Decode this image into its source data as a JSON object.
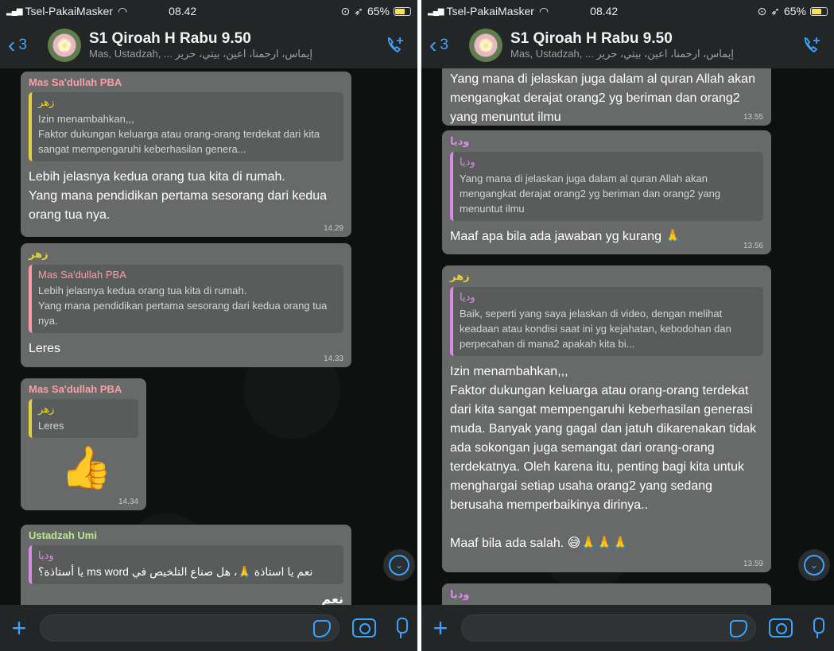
{
  "colors": {
    "accent": "#3aa3ff",
    "bubble": "#686a69",
    "sender_mas": "#ff9ba5",
    "sender_zahr": "#e6d23a",
    "sender_umi": "#b8e986",
    "sender_wadia": "#d98ce6",
    "battery": "#ffe14d"
  },
  "status": {
    "carrier": "Tsel-PakaiMasker",
    "time": "08.42",
    "battery": "65%"
  },
  "header": {
    "back_count": "3",
    "title": "S1 Qiroah H Rabu 9.50",
    "members": "Mas, Ustadzah, ... إيماس، ارحمنا، اعين، بيتي، حرير"
  },
  "left_chat": {
    "m1": {
      "sender": "Mas Sa'dullah PBA",
      "quote_author": "زهر",
      "quote_text": "Izin menambahkan,,,\nFaktor dukungan keluarga atau orang-orang terdekat dari kita sangat mempengaruhi keberhasilan genera...",
      "body": "Lebih jelasnya kedua orang tua kita di rumah.\nYang mana pendidikan pertama sesorang dari kedua orang tua nya.",
      "time": "14.29"
    },
    "m2": {
      "sender": "زهر",
      "quote_author": "Mas Sa'dullah PBA",
      "quote_text": "Lebih jelasnya kedua orang tua kita di rumah.\nYang mana pendidikan pertama sesorang dari kedua orang tua nya.",
      "body": "Leres",
      "time": "14.33"
    },
    "m3": {
      "sender": "Mas Sa'dullah PBA",
      "quote_author": "زهر",
      "quote_text": "Leres",
      "emoji": "👍",
      "time": "14.34"
    },
    "m4": {
      "sender": "Ustadzah Umi",
      "quote_author": "وديا",
      "quote_text": "نعم يا استاذة 🙏، هل صناع التلخيص في ms word يا أستاذة؟",
      "body": "نعم"
    }
  },
  "right_chat": {
    "m1": {
      "body": "Yang mana di jelaskan juga dalam al quran Allah akan mengangkat derajat orang2 yg beriman dan orang2 yang menuntut ilmu",
      "time": "13.55"
    },
    "m2": {
      "sender": "وديا",
      "quote_author": "وديا",
      "quote_text": "Yang mana di jelaskan juga dalam al quran Allah akan mengangkat derajat orang2 yg beriman dan orang2 yang menuntut ilmu",
      "body": "Maaf apa bila ada jawaban yg kurang 🙏",
      "time": "13.56"
    },
    "m3": {
      "sender": "زهر",
      "quote_author": "وديا",
      "quote_text": "Baik, seperti yang saya jelaskan di video, dengan melihat keadaan atau kondisi saat ini yg kejahatan, kebodohan dan perpecahan di mana2 apakah kita bi...",
      "body": "Izin menambahkan,,,\nFaktor dukungan keluarga atau orang-orang terdekat dari kita sangat mempengaruhi keberhasilan generasi muda. Banyak yang gagal dan jatuh dikarenakan tidak ada sokongan juga semangat dari orang-orang terdekatnya. Oleh karena itu, penting bagi kita untuk menghargai setiap usaha orang2 yang sedang berusaha memperbaikinya dirinya..\n\nMaaf bila ada salah. 😅🙏🙏🙏",
      "time": "13.59"
    },
    "m4": {
      "sender": "وديا"
    }
  }
}
